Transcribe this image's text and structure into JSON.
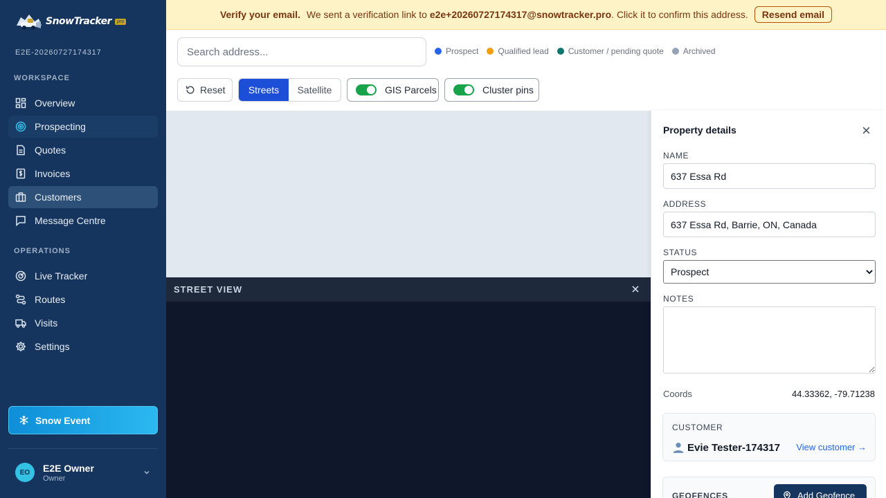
{
  "app": {
    "brand": "SnowTracker",
    "brand_badge": "pro",
    "org_name": "E2E-20260727174317",
    "accent": "#1d4ed8",
    "sidebar_bg": "#16355e"
  },
  "sidebar": {
    "workspace_label": "WORKSPACE",
    "operations_label": "OPERATIONS",
    "workspace_items": [
      {
        "label": "Overview",
        "icon": "grid-icon"
      },
      {
        "label": "Prospecting",
        "icon": "target-icon"
      },
      {
        "label": "Quotes",
        "icon": "document-icon"
      },
      {
        "label": "Invoices",
        "icon": "invoice-icon"
      },
      {
        "label": "Customers",
        "icon": "briefcase-icon"
      },
      {
        "label": "Message Centre",
        "icon": "message-icon"
      }
    ],
    "operations_items": [
      {
        "label": "Live Tracker",
        "icon": "radar-icon"
      },
      {
        "label": "Routes",
        "icon": "route-icon"
      },
      {
        "label": "Visits",
        "icon": "truck-icon"
      },
      {
        "label": "Settings",
        "icon": "gear-icon"
      }
    ],
    "snow_event_label": "Snow Event",
    "user": {
      "initials": "EO",
      "name": "E2E Owner",
      "role": "Owner"
    }
  },
  "banner": {
    "title": "Verify your email.",
    "message_before": "We sent a verification link to",
    "email": "e2e+20260727174317@snowtracker.pro",
    "message_after": ". Click it to confirm this address.",
    "button": "Resend email"
  },
  "toolbar": {
    "search_placeholder": "Search address...",
    "legend": [
      {
        "label": "Prospect",
        "color": "#2563eb"
      },
      {
        "label": "Qualified lead",
        "color": "#f59e0b"
      },
      {
        "label": "Customer / pending quote",
        "color": "#0f766e"
      },
      {
        "label": "Archived",
        "color": "#94a3b8"
      }
    ],
    "reset_label": "Reset",
    "streets_label": "Streets",
    "satellite_label": "Satellite",
    "gis_label": "GIS Parcels",
    "cluster_label": "Cluster pins"
  },
  "street_view": {
    "title": "STREET VIEW"
  },
  "details": {
    "title": "Property details",
    "name_label": "NAME",
    "name_value": "637 Essa Rd",
    "address_label": "ADDRESS",
    "address_value": "637 Essa Rd, Barrie, ON, Canada",
    "status_label": "STATUS",
    "status_value": "Prospect",
    "notes_label": "NOTES",
    "notes_value": "",
    "coords_label": "Coords",
    "coords_value": "44.33362, -79.71238",
    "customer_label": "CUSTOMER",
    "customer_name": "Evie Tester-174317",
    "customer_link": "View customer →",
    "geofences_label": "GEOFENCES",
    "add_geofence_label": "Add Geofence"
  }
}
